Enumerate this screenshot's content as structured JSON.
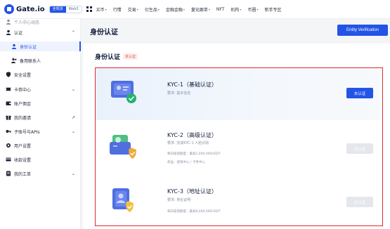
{
  "topnav": {
    "brand": "Gate.io",
    "brand_badge": "",
    "mode_on": "全现货",
    "mode_off": "Web3",
    "items": [
      {
        "label": "买币",
        "caret": "▾"
      },
      {
        "label": "行情",
        "caret": ""
      },
      {
        "label": "交易",
        "caret": "▾"
      },
      {
        "label": "衍生品",
        "caret": "▾"
      },
      {
        "label": "金融金融",
        "caret": "▾"
      },
      {
        "label": "量化跟单",
        "caret": "▾"
      },
      {
        "label": "NFT",
        "caret": ""
      },
      {
        "label": "机构",
        "caret": "▾"
      },
      {
        "label": "币圈",
        "caret": "▾"
      },
      {
        "label": "新手专区",
        "caret": ""
      }
    ]
  },
  "sidebar": {
    "items": [
      {
        "label": "个人中心动态",
        "icon": "user-icon",
        "faded": true
      },
      {
        "label": "认证",
        "icon": "user-icon",
        "chevron": "⌃"
      },
      {
        "label": "身份认证",
        "icon": "user-icon",
        "active": true
      },
      {
        "label": "备用联系人",
        "icon": "contact-icon"
      },
      {
        "label": "安全设置",
        "icon": "shield-icon"
      },
      {
        "label": "卡券中心",
        "icon": "ticket-icon",
        "chevron": "⌄"
      },
      {
        "label": "账户佣金",
        "icon": "wallet-icon"
      },
      {
        "label": "我的邀请",
        "icon": "gift-icon",
        "chevron": "↗"
      },
      {
        "label": "子账号与APIs",
        "icon": "key-icon",
        "chevron": "⌄"
      },
      {
        "label": "用户设置",
        "icon": "gear-icon"
      },
      {
        "label": "收款设置",
        "icon": "card-icon"
      },
      {
        "label": "我的工单",
        "icon": "ticket-icon",
        "chevron": "⌄"
      }
    ]
  },
  "main": {
    "page_title": "身份认证",
    "entity_button": "Entity Verification",
    "section_title": "身份认证",
    "status_tag": "未认证"
  },
  "kyc": [
    {
      "title": "KYC-1（基础认证）",
      "desc": "要求: 基本信息",
      "bullets": [],
      "button": "去认证",
      "enabled": true,
      "accent": "#1fb56b"
    },
    {
      "title": "KYC-2（高级认证）",
      "desc": "要求: 完成KYC-1 人脸识别",
      "bullets": [
        "每日提现额度：最高2,000,000USDT",
        "权益：提现中心 / 卡券中心"
      ],
      "button": "去认证",
      "enabled": false,
      "accent": "#f0a93a"
    },
    {
      "title": "KYC-3（地址认证）",
      "desc": "要求: 地址证明",
      "bullets": [
        "每日提现额度：最高8,000,000USDT"
      ],
      "button": "去认证",
      "enabled": false,
      "accent": "#f0c23a"
    }
  ]
}
